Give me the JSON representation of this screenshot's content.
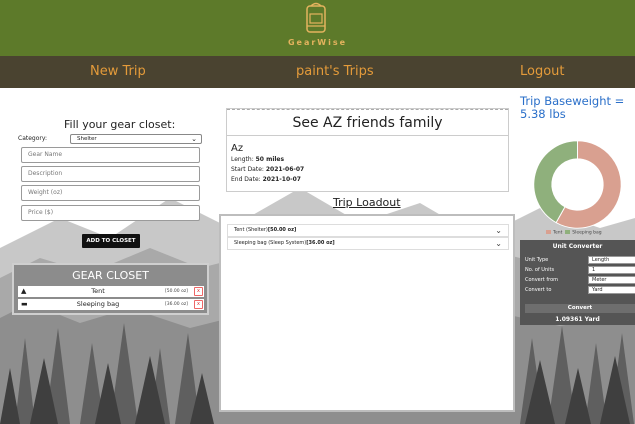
{
  "header": {
    "logo_text": "GearWise",
    "nav": {
      "new_trip": "New Trip",
      "trips": "paint's Trips",
      "logout": "Logout"
    }
  },
  "form": {
    "title": "Fill your gear closet:",
    "category_label": "Category:",
    "category_value": "Shelter",
    "fields": {
      "name_placeholder": "Gear Name",
      "description_placeholder": "Description",
      "weight_placeholder": "Weight (oz)",
      "price_placeholder": "Price ($)"
    },
    "add_button": "ADD TO CLOSET"
  },
  "closet": {
    "title": "GEAR CLOSET",
    "items": [
      {
        "name": "Tent",
        "weight": "[50.00 oz]",
        "icon": "tent-icon"
      },
      {
        "name": "Sleeping bag",
        "weight": "[36.00 oz]",
        "icon": "bed-icon"
      }
    ],
    "remove_label": "x"
  },
  "trip": {
    "heading": "See AZ friends family",
    "name": "Az",
    "length_label": "Length: ",
    "length_value": "50 miles",
    "start_label": "Start Date: ",
    "start_value": "2021-06-07",
    "end_label": "End Date: ",
    "end_value": "2021-10-07"
  },
  "loadout": {
    "title": "Trip Loadout",
    "items": [
      {
        "label_main": "Tent (Shelter)",
        "label_weight": "[50.00 oz]"
      },
      {
        "label_main": "Sleeping bag (Sleep System)",
        "label_weight": "[36.00 oz]"
      }
    ]
  },
  "baseweight": {
    "text": "Trip Baseweight = 5.38 lbs"
  },
  "chart_data": {
    "type": "pie",
    "categories": [
      "Tent",
      "Sleeping bag"
    ],
    "values": [
      50,
      36
    ],
    "colors": [
      "#d9a090",
      "#8fb07c"
    ],
    "legend": "bottom"
  },
  "converter": {
    "title": "Unit Converter",
    "rows": [
      {
        "label": "Unit Type",
        "value": "Length"
      },
      {
        "label": "No. of Units",
        "value": "1"
      },
      {
        "label": "Convert from",
        "value": "Meter"
      },
      {
        "label": "Convert to",
        "value": "Yard"
      }
    ],
    "button": "Convert",
    "result": "1.09361 Yard"
  },
  "colors": {
    "header_green": "#5d7a2a",
    "nav_brown": "#4a4330",
    "nav_link": "#e49b3a",
    "accent_blue": "#2a6fc9"
  }
}
